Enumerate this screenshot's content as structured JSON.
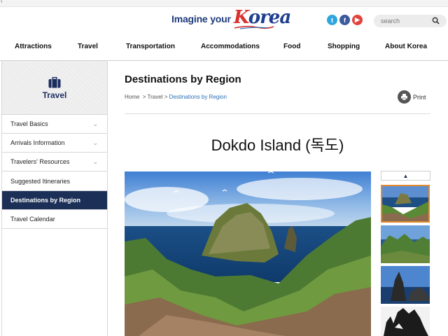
{
  "browser": {
    "corner_mark": "\\"
  },
  "header": {
    "logo_imagine": "Imagine your",
    "logo_korea": "Korea",
    "social": [
      "twitter-icon",
      "facebook-icon",
      "youtube-icon"
    ],
    "search_placeholder": "search"
  },
  "nav": {
    "items": [
      "Attractions",
      "Travel",
      "Transportation",
      "Accommodations",
      "Food",
      "Shopping",
      "About Korea"
    ]
  },
  "sidebar": {
    "title": "Travel",
    "items": [
      {
        "label": "Travel Basics",
        "has_chevron": true
      },
      {
        "label": "Arrivals Information",
        "has_chevron": true
      },
      {
        "label": "Travelers' Resources",
        "has_chevron": true
      },
      {
        "label": "Suggested Itineraries",
        "has_chevron": false
      },
      {
        "label": "Destinations by Region",
        "has_chevron": false,
        "active": true
      },
      {
        "label": "Travel Calendar",
        "has_chevron": false
      }
    ]
  },
  "content": {
    "title": "Destinations by Region",
    "breadcrumb": {
      "home": "Home",
      "sep": ">",
      "travel": "Travel",
      "current": "Destinations by Region"
    },
    "print_label": "Print",
    "headline": "Dokdo Island (독도)"
  },
  "gallery": {
    "up_arrow": "▲",
    "selected_index": 0
  },
  "colors": {
    "nav_active_bg": "#1c2f57",
    "link_blue": "#2a6fb5",
    "thumb_selected_border": "#e38a2f"
  }
}
